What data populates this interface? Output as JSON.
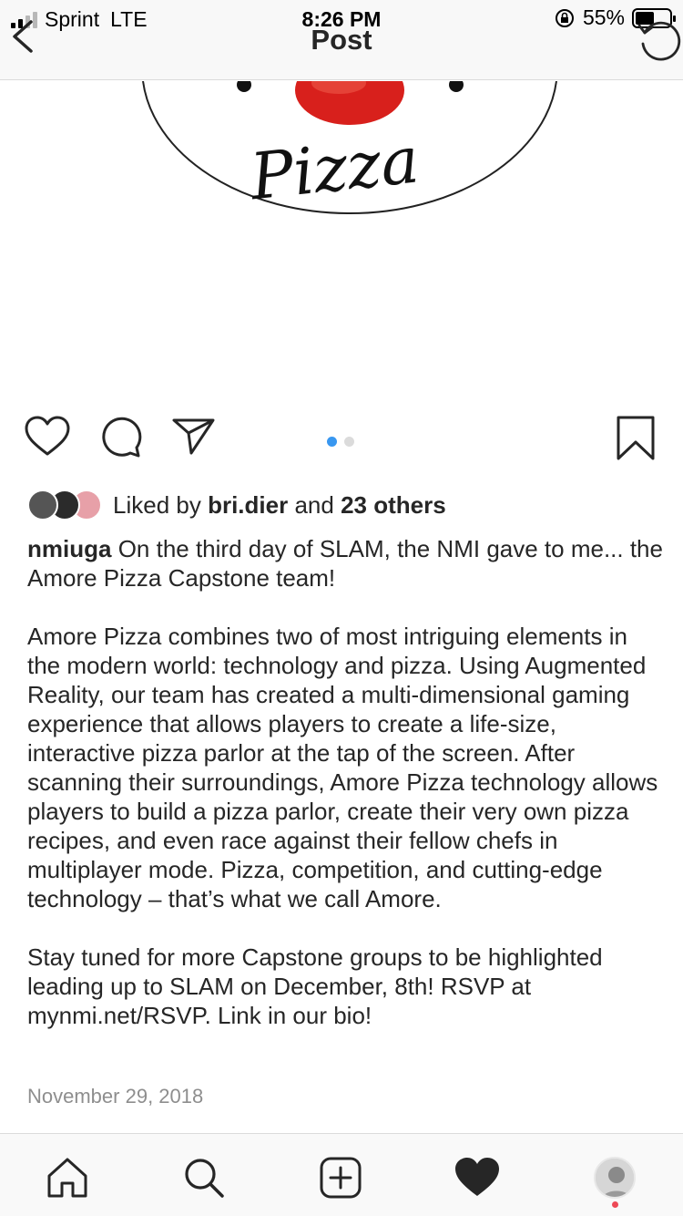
{
  "status_bar": {
    "carrier": "Sprint",
    "network": "LTE",
    "time": "8:26 PM",
    "battery": "55%",
    "battery_level": 0.55
  },
  "header": {
    "title": "Post"
  },
  "post": {
    "image_text": "Pizza",
    "carousel": {
      "count": 2,
      "active_index": 0
    },
    "liked_by_prefix": "Liked by",
    "liked_by_user": "bri.dier",
    "liked_by_and": "and",
    "liked_by_others": "23 others",
    "username": "nmiuga",
    "caption_first": "On the third day of SLAM, the NMI gave to me... the Amore Pizza Capstone team!",
    "caption_p2": "Amore Pizza combines two of most intriguing elements in the modern world: technology and pizza. Using Augmented Reality, our team has created a multi-dimensional gaming experience that allows players to create a life-size, interactive pizza parlor at the tap of the screen. After scanning their surroundings, Amore Pizza technology allows players to build a pizza parlor, create their very own pizza recipes, and even race against their fellow chefs in multiplayer mode. Pizza, competition, and cutting-edge technology – that’s what we call Amore.",
    "caption_p3": "Stay tuned for more Capstone groups to be highlighted leading up to SLAM on December, 8th! RSVP at mynmi.net/RSVP. Link in our bio!",
    "date": "November 29, 2018"
  },
  "icons": {
    "back": "chevron-left-icon",
    "refresh": "refresh-icon",
    "like": "heart-outline-icon",
    "comment": "comment-icon",
    "share": "paper-plane-icon",
    "save": "bookmark-icon",
    "nav": [
      "home-icon",
      "search-icon",
      "add-post-icon",
      "activity-heart-icon",
      "profile-avatar"
    ]
  },
  "colors": {
    "accent": "#3897f0",
    "notification": "#ed4956",
    "text": "#262626",
    "muted": "#8e8e8e",
    "pizza_red": "#d8201c"
  }
}
